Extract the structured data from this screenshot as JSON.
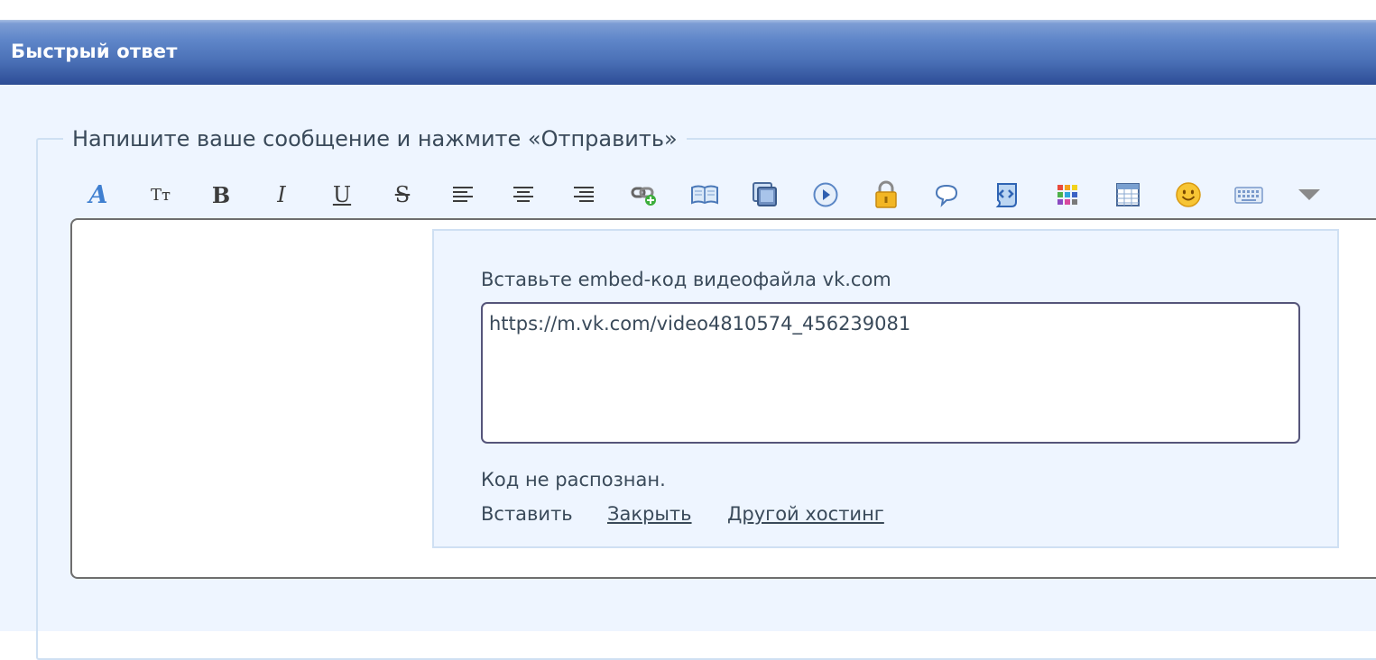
{
  "header": {
    "title": "Быстрый ответ"
  },
  "form": {
    "legend": "Напишите ваше сообщение и нажмите «Отправить»"
  },
  "toolbar": {
    "font_glyph": "A",
    "size_glyph": "Tт",
    "bold_glyph": "B",
    "italic_glyph": "I",
    "underline_glyph": "U",
    "strike_glyph": "S"
  },
  "popup": {
    "label": "Вставьте embed-код видеофайла vk.com",
    "input_value": "https://m.vk.com/video4810574_456239081",
    "status": "Код не распознан.",
    "insert_label": "Вставить",
    "close_label": "Закрыть",
    "other_hosting_label": "Другой хостинг"
  },
  "colors": {
    "header_top": "#7d9dd4",
    "header_bottom": "#2f4f98",
    "panel_bg": "#eef5ff",
    "text": "#3a4a5a"
  }
}
